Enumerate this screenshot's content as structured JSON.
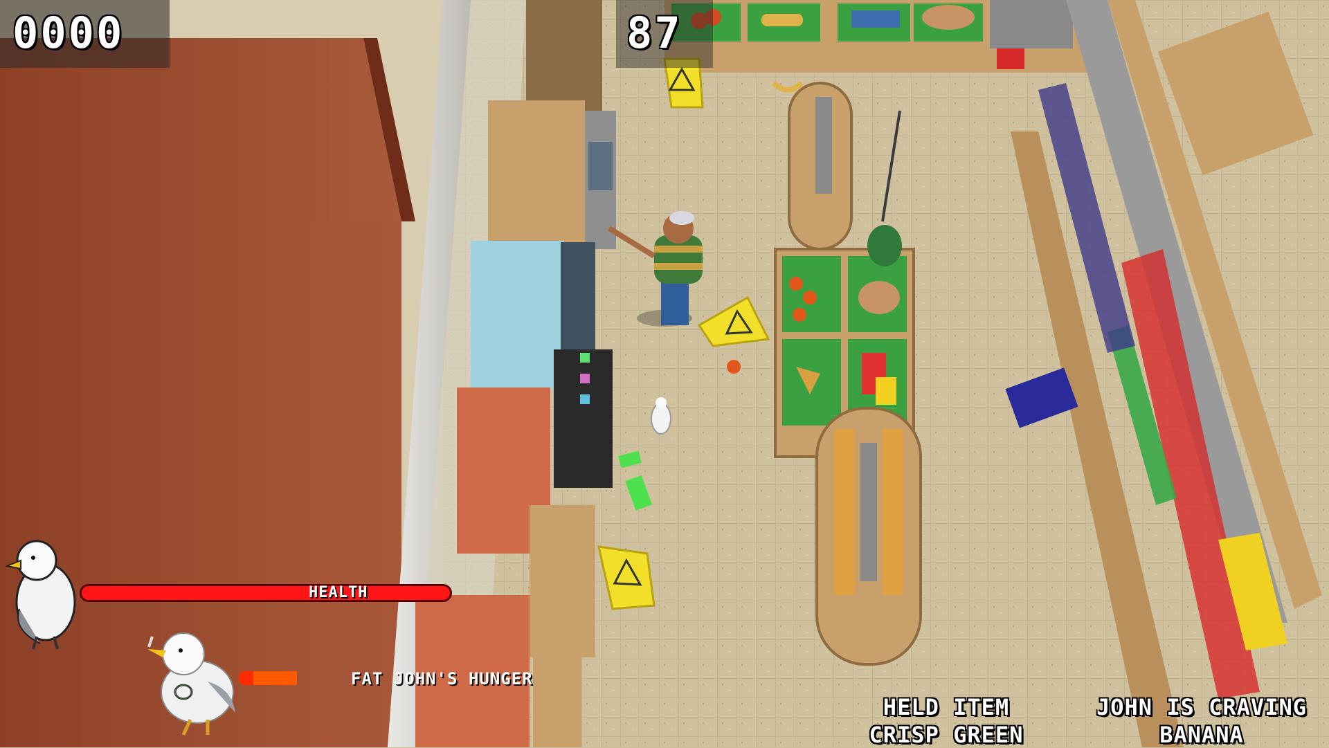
{
  "hud": {
    "score": "0000",
    "timer": "87",
    "health_label": "HEALTH",
    "health_level": 1.0,
    "hunger_label": "FAT JOHN'S HUNGER",
    "hunger_level": 0.25,
    "held_item_title": "HELD ITEM",
    "held_item_value": "CRISP GREEN",
    "craving_title": "JOHN IS CRAVING",
    "craving_value": "BANANA"
  },
  "colors": {
    "health_bar": "#ff1515",
    "hunger_bar": "#ff5a00",
    "floor": "#cdbf9c",
    "brick_roof": "#9a4a2e",
    "shelf_wood": "#c8a06c",
    "produce_crate": "#3aa040"
  },
  "icons": {
    "player_avatar": "seagull-icon",
    "john_avatar": "seagull-with-cigarette-icon"
  }
}
